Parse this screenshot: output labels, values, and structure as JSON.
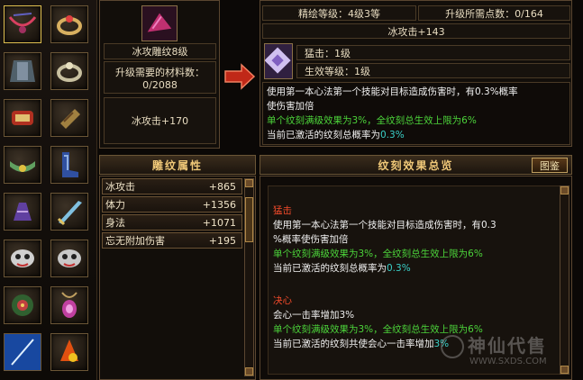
{
  "top_right": {
    "refine_level": "精绘等级：4级3等",
    "required_points": "升级所需点数：0/164",
    "bonus": "冰攻击+143",
    "skill_name": "猛击：1级",
    "effect_level": "生效等级：1级",
    "desc_line1": "使用第一本心法第一个技能对目标造成伤害时，有0.3%概率",
    "desc_line2": "使伤害加倍",
    "desc_line3": "单个纹刻满级效果为3%，全纹刻总生效上限为6%",
    "desc_line4_prefix": "当前已激活的纹刻总概率为",
    "desc_line4_value": "0.3%"
  },
  "top_left": {
    "name": "冰攻雕纹8级",
    "materials_label": "升级需要的材料数：",
    "materials_value": "0/2088",
    "bonus": "冰攻击+170"
  },
  "attributes": {
    "title": "雕纹属性",
    "rows": [
      {
        "name": "冰攻击",
        "value": "+865"
      },
      {
        "name": "体力",
        "value": "+1356"
      },
      {
        "name": "身法",
        "value": "+1071"
      },
      {
        "name": "忘无附加伤害",
        "value": "+195"
      }
    ]
  },
  "summary": {
    "title": "纹刻效果总览",
    "button": "图鉴",
    "s1_title": "猛击",
    "s1_line1": "使用第一本心法第一个技能对目标造成伤害时，有0.3",
    "s1_line2": "%概率使伤害加倍",
    "s1_line3": "单个纹刻满级效果为3%，全纹刻总生效上限为6%",
    "s1_line4_prefix": "当前已激活的纹刻总概率为",
    "s1_line4_value": "0.3%",
    "s2_title": "决心",
    "s2_line1": "会心一击率增加3%",
    "s2_line2": "单个纹刻满级效果为3%，全纹刻总生效上限为6%",
    "s2_line3_prefix": "当前已激活的纹刻共使会心一击率增加",
    "s2_line3_value": "3%"
  },
  "watermark": {
    "text": "神仙代售",
    "url": "WWW.SXDS.COM"
  },
  "colors": {
    "accent": "#f0c878",
    "green": "#4cd43a",
    "red": "#f04a2a",
    "teal": "#3ad0c8"
  }
}
